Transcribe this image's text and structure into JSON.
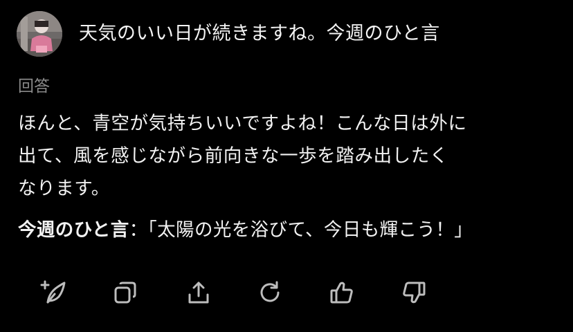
{
  "question": {
    "title": "天気のいい日が続きますね。今週のひと言"
  },
  "answer": {
    "label": "回答",
    "lines": [
      "ほんと、青空が気持ちいいですよね！こんな日は外に",
      "出て、風を感じながら前向きな一歩を踏み出したく",
      "なります。"
    ],
    "quote_label": "今週のひと言",
    "quote_text": "：「太陽の光を浴びて、今日も輝こう！」"
  },
  "actions": [
    {
      "icon": "sparkle-quill-icon"
    },
    {
      "icon": "copy-icon"
    },
    {
      "icon": "share-icon"
    },
    {
      "icon": "regenerate-icon"
    },
    {
      "icon": "thumbs-up-icon"
    },
    {
      "icon": "thumbs-down-icon"
    }
  ],
  "colors": {
    "background": "#000000",
    "text": "#f2f2f2",
    "muted": "#8a8a8a",
    "icon": "#bdbdbd"
  }
}
